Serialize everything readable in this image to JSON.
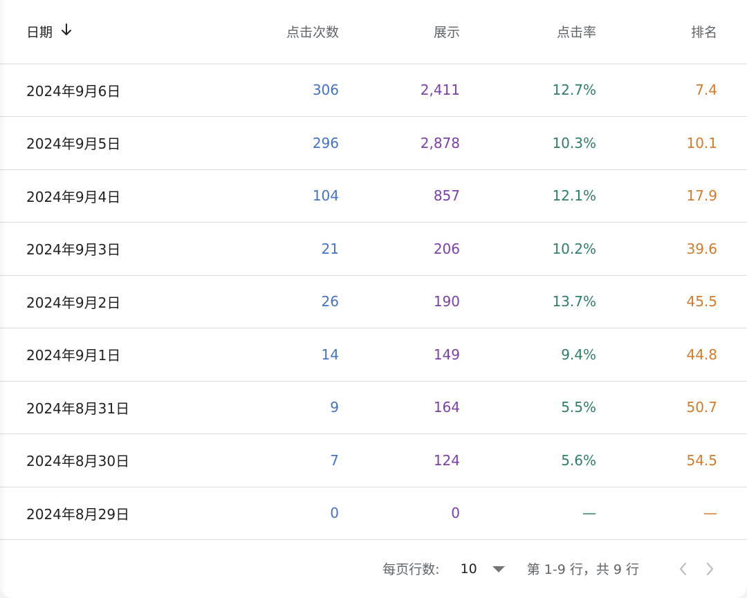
{
  "header": {
    "date": "日期",
    "clicks": "点击次数",
    "impressions": "展示",
    "ctr": "点击率",
    "position": "排名",
    "sort_icon": "arrow-down-icon"
  },
  "rows": [
    {
      "date": "2024年9月6日",
      "clicks": "306",
      "impressions": "2,411",
      "ctr": "12.7%",
      "position": "7.4"
    },
    {
      "date": "2024年9月5日",
      "clicks": "296",
      "impressions": "2,878",
      "ctr": "10.3%",
      "position": "10.1"
    },
    {
      "date": "2024年9月4日",
      "clicks": "104",
      "impressions": "857",
      "ctr": "12.1%",
      "position": "17.9"
    },
    {
      "date": "2024年9月3日",
      "clicks": "21",
      "impressions": "206",
      "ctr": "10.2%",
      "position": "39.6"
    },
    {
      "date": "2024年9月2日",
      "clicks": "26",
      "impressions": "190",
      "ctr": "13.7%",
      "position": "45.5"
    },
    {
      "date": "2024年9月1日",
      "clicks": "14",
      "impressions": "149",
      "ctr": "9.4%",
      "position": "44.8"
    },
    {
      "date": "2024年8月31日",
      "clicks": "9",
      "impressions": "164",
      "ctr": "5.5%",
      "position": "50.7"
    },
    {
      "date": "2024年8月30日",
      "clicks": "7",
      "impressions": "124",
      "ctr": "5.6%",
      "position": "54.5"
    },
    {
      "date": "2024年8月29日",
      "clicks": "0",
      "impressions": "0",
      "ctr": "—",
      "position": "—"
    }
  ],
  "footer": {
    "rows_per_page_label": "每页行数:",
    "rows_per_page_value": "10",
    "range_text": "第 1-9 行，共 9 行",
    "dropdown_icon": "triangle-down-icon",
    "prev_icon": "chevron-left-icon",
    "next_icon": "chevron-right-icon"
  },
  "colors": {
    "clicks": "#4472c4",
    "impressions": "#7b3fa8",
    "ctr": "#2e7d6a",
    "position": "#d47a2c",
    "divider": "#dadce0",
    "text": "#202124",
    "muted": "#5f6368"
  }
}
